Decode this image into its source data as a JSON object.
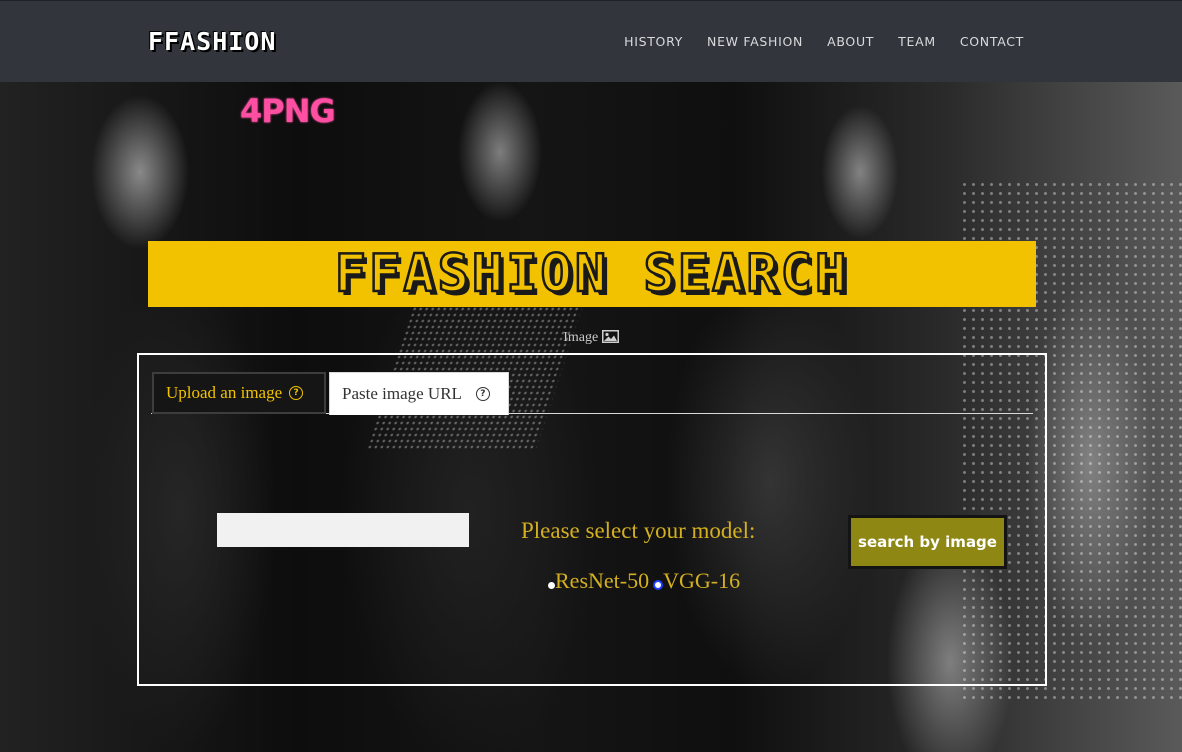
{
  "navbar": {
    "brand": "FFASHION",
    "links": [
      {
        "label": "HISTORY"
      },
      {
        "label": "NEW FASHION"
      },
      {
        "label": "ABOUT"
      },
      {
        "label": "TEAM"
      },
      {
        "label": "CONTACT"
      }
    ]
  },
  "hero": {
    "watermark": "4PNG",
    "title": "FFASHION SEARCH",
    "image_caption": "Image",
    "accent_color": "#f2c200",
    "nav_bg": "#32363c"
  },
  "search_panel": {
    "tabs": [
      {
        "label": "Upload an image",
        "active": true
      },
      {
        "label": "Paste image URL",
        "active": false
      }
    ],
    "url_input": {
      "value": "",
      "placeholder": ""
    },
    "model_prompt": "Please select your model:",
    "models": [
      {
        "label": "ResNet-50",
        "selected": false
      },
      {
        "label": "VGG-16",
        "selected": true
      }
    ],
    "search_button": "search by image",
    "button_color": "#8e8713"
  }
}
